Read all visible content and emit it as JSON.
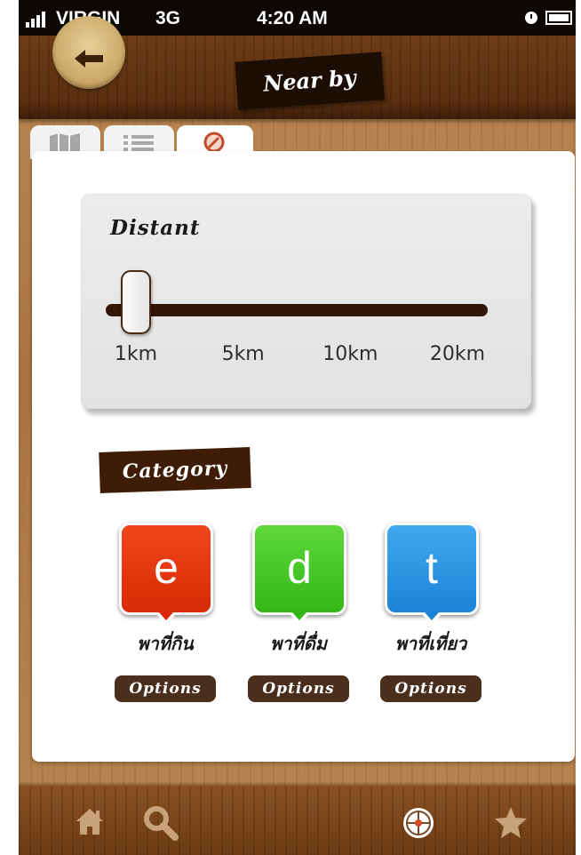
{
  "status_bar": {
    "carrier": "VIRGIN",
    "network": "3G",
    "time": "4:20 AM",
    "icons": [
      "signal-icon",
      "alarm-icon",
      "battery-icon"
    ]
  },
  "header": {
    "title": "Near by",
    "back_icon": "back-arrow-icon"
  },
  "tabs": [
    {
      "icon": "map-icon",
      "selected": false
    },
    {
      "icon": "list-icon",
      "selected": false
    },
    {
      "icon": "compass-icon",
      "selected": true
    }
  ],
  "distance": {
    "label": "Distant",
    "options": [
      "1km",
      "5km",
      "10km",
      "20km"
    ],
    "selected": "1km"
  },
  "category": {
    "label": "Category",
    "items": [
      {
        "letter": "e",
        "name": "พาที่กิน",
        "button": "Options",
        "color": "#e8380f"
      },
      {
        "letter": "d",
        "name": "พาที่ดื่ม",
        "button": "Options",
        "color": "#46c724"
      },
      {
        "letter": "t",
        "name": "พาที่เที่ยว",
        "button": "Options",
        "color": "#2b95e3"
      }
    ]
  },
  "bottom_nav": [
    "home-icon",
    "search-icon",
    "locate-icon",
    "favorite-icon"
  ],
  "colors": {
    "header_wood": "#5a2f10",
    "plaque": "#1d0e05",
    "slider_track": "#321607",
    "options_button": "#4a2f1d"
  }
}
